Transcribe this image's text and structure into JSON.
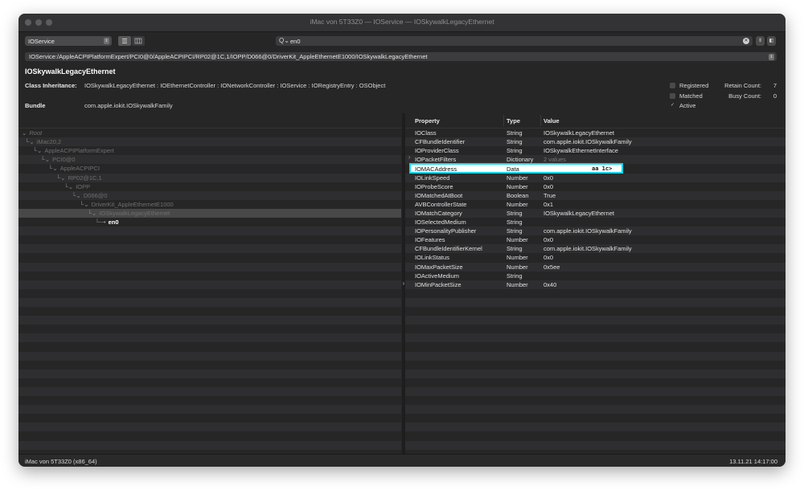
{
  "window": {
    "title": "iMac von 5T33Z0 — IOService — IOSkywalkLegacyEthernet"
  },
  "toolbar": {
    "plane_select": "IOService",
    "search_value": "en0"
  },
  "path": "IOService:/AppleACPIPlatformExpert/PCI0@0/AppleACPIPCI/RP02@1C,1/IOPP/D066@0/DriverKit_AppleEthernetE1000/IOSkywalkLegacyEthernet",
  "object": {
    "name": "IOSkywalkLegacyEthernet",
    "class_inheritance_label": "Class Inheritance:",
    "class_inheritance": "IOSkywalkLegacyEthernet : IOEthernetController : IONetworkController : IOService : IORegistryEntry : OSObject",
    "bundle_label": "Bundle",
    "bundle": "com.apple.iokit.IOSkywalkFamily"
  },
  "flags": [
    {
      "label": "Registered",
      "checked": false
    },
    {
      "label": "Matched",
      "checked": false
    },
    {
      "label": "Active",
      "checked": true
    }
  ],
  "counts": [
    {
      "label": "Retain Count:",
      "value": "7"
    },
    {
      "label": "Busy Count:",
      "value": "0"
    }
  ],
  "tree": [
    {
      "label": "Root",
      "depth": 0,
      "italic": true
    },
    {
      "label": "iMac20,2",
      "depth": 1
    },
    {
      "label": "AppleACPIPlatformExpert",
      "depth": 2
    },
    {
      "label": "PCI0@0",
      "depth": 3
    },
    {
      "label": "AppleACPIPCI",
      "depth": 4
    },
    {
      "label": "RP02@1C,1",
      "depth": 5
    },
    {
      "label": "IOPP",
      "depth": 6
    },
    {
      "label": "D066@0",
      "depth": 7
    },
    {
      "label": "DriverKit_AppleEthernetE1000",
      "depth": 8
    },
    {
      "label": "IOSkywalkLegacyEthernet",
      "depth": 9,
      "selected": true
    },
    {
      "label": "en0",
      "depth": 10,
      "focus": true
    }
  ],
  "properties": {
    "headers": {
      "property": "Property",
      "type": "Type",
      "value": "Value"
    },
    "rows": [
      {
        "property": "IOClass",
        "type": "String",
        "value": "IOSkywalkLegacyEthernet"
      },
      {
        "property": "CFBundleIdentifier",
        "type": "String",
        "value": "com.apple.iokit.IOSkywalkFamily"
      },
      {
        "property": "IOProviderClass",
        "type": "String",
        "value": "IOSkywalkEthernetInterface"
      },
      {
        "property": "IOPacketFilters",
        "type": "Dictionary",
        "value": "2 values",
        "expandable": true
      },
      {
        "property": "IOMACAddress",
        "type": "Data",
        "value": "aa 1c>",
        "highlight": true
      },
      {
        "property": "IOLinkSpeed",
        "type": "Number",
        "value": "0x0"
      },
      {
        "property": "IOProbeScore",
        "type": "Number",
        "value": "0x0"
      },
      {
        "property": "IOMatchedAtBoot",
        "type": "Boolean",
        "value": "True"
      },
      {
        "property": "AVBControllerState",
        "type": "Number",
        "value": "0x1"
      },
      {
        "property": "IOMatchCategory",
        "type": "String",
        "value": "IOSkywalkLegacyEthernet"
      },
      {
        "property": "IOSelectedMedium",
        "type": "String",
        "value": ""
      },
      {
        "property": "IOPersonalityPublisher",
        "type": "String",
        "value": "com.apple.iokit.IOSkywalkFamily"
      },
      {
        "property": "IOFeatures",
        "type": "Number",
        "value": "0x0"
      },
      {
        "property": "CFBundleIdentifierKernel",
        "type": "String",
        "value": "com.apple.iokit.IOSkywalkFamily"
      },
      {
        "property": "IOLinkStatus",
        "type": "Number",
        "value": "0x0"
      },
      {
        "property": "IOMaxPacketSize",
        "type": "Number",
        "value": "0x5ee"
      },
      {
        "property": "IOActiveMedium",
        "type": "String",
        "value": ""
      },
      {
        "property": "IOMinPacketSize",
        "type": "Number",
        "value": "0x40"
      }
    ]
  },
  "status": {
    "left": "iMac von 5T33Z0 (x86_64)",
    "right": "13.11.21 14:17:00"
  },
  "colors": {
    "highlight_border": "#17d7e6",
    "window_bg": "#262626"
  }
}
